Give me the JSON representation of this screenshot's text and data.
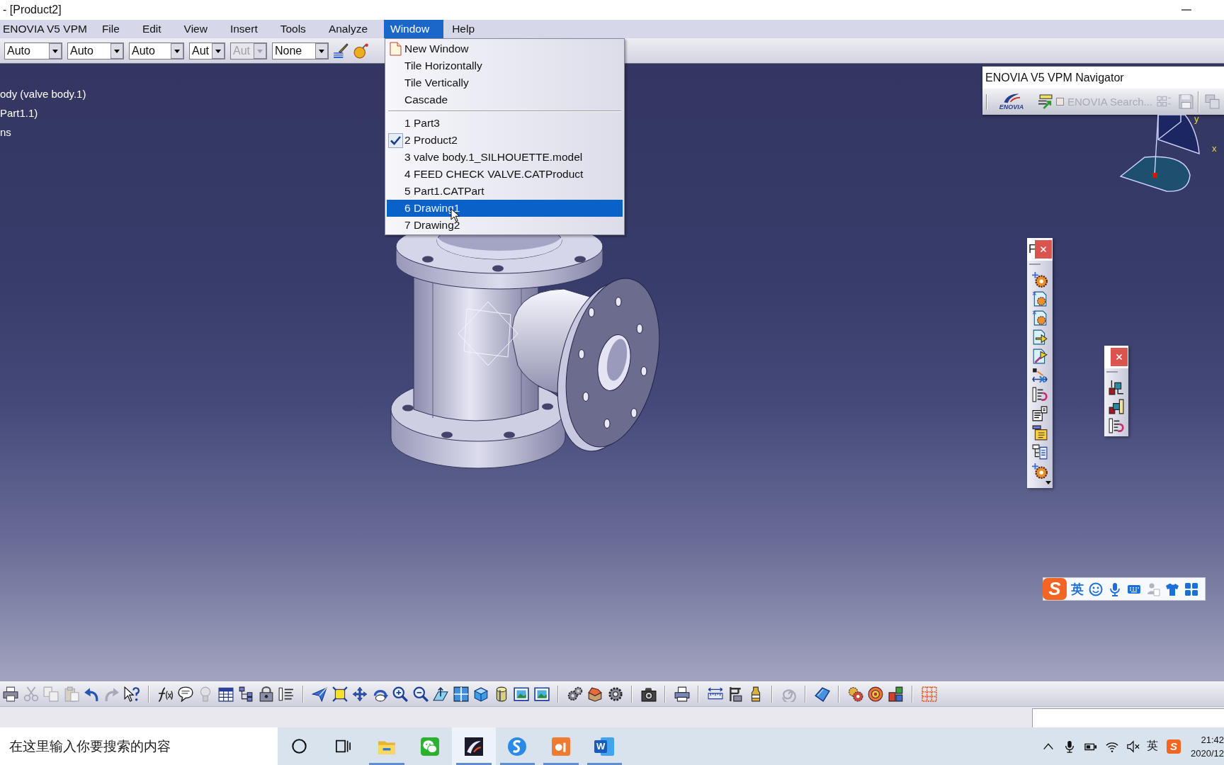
{
  "window": {
    "title": "- [Product2]"
  },
  "menu_bar": [
    {
      "label": "ENOVIA V5 VPM",
      "selected": false
    },
    {
      "label": "File",
      "selected": false
    },
    {
      "label": "Edit",
      "selected": false
    },
    {
      "label": "View",
      "selected": false
    },
    {
      "label": "Insert",
      "selected": false
    },
    {
      "label": "Tools",
      "selected": false
    },
    {
      "label": "Analyze",
      "selected": false
    },
    {
      "label": "Window",
      "selected": true
    },
    {
      "label": "Help",
      "selected": false
    }
  ],
  "graphic_properties": [
    {
      "value": "Auto",
      "disabled": false
    },
    {
      "value": "Auto",
      "disabled": false
    },
    {
      "value": "Auto",
      "disabled": false
    },
    {
      "value": "Aut",
      "disabled": false
    },
    {
      "value": "Aut",
      "disabled": true
    },
    {
      "value": "None",
      "disabled": false
    }
  ],
  "window_menu": [
    {
      "kind": "new",
      "label": "New Window",
      "selected": false
    },
    {
      "kind": "command",
      "label": "Tile Horizontally",
      "selected": false
    },
    {
      "kind": "command",
      "label": "Tile Vertically",
      "selected": false
    },
    {
      "kind": "command",
      "label": "Cascade",
      "selected": false
    },
    {
      "kind": "separator"
    },
    {
      "kind": "window",
      "label": "1 Part3",
      "checked": false,
      "selected": false
    },
    {
      "kind": "window",
      "label": "2 Product2",
      "checked": true,
      "selected": false
    },
    {
      "kind": "window",
      "label": "3 valve body.1_SILHOUETTE.model",
      "checked": false,
      "selected": false
    },
    {
      "kind": "window",
      "label": "4 FEED CHECK VALVE.CATProduct",
      "checked": false,
      "selected": false
    },
    {
      "kind": "window",
      "label": "5 Part1.CATPart",
      "checked": false,
      "selected": false
    },
    {
      "kind": "window",
      "label": "6 Drawing1",
      "checked": false,
      "selected": true
    },
    {
      "kind": "window",
      "label": "7 Drawing2",
      "checked": false,
      "selected": false
    }
  ],
  "specification_tree": [
    "ody (valve body.1)",
    "Part1.1)",
    "ns"
  ],
  "navigator": {
    "title": "ENOVIA V5 VPM Navigator",
    "logo_text": "ENOVIA",
    "search": {
      "label": "ENOVIA Search...",
      "checked": false,
      "disabled": true
    }
  },
  "compass": {
    "axis_labels": [
      "y",
      "x"
    ]
  },
  "floating_toolbar": {
    "title": "F"
  },
  "ime_bar": {
    "logo": "S",
    "mode": "英"
  },
  "taskbar": {
    "search": {
      "placeholder": "在这里输入你要搜索的内容"
    },
    "apps": [
      {
        "kind": "folder",
        "running": true,
        "selected": false
      },
      {
        "kind": "chat",
        "running": false,
        "selected": false
      },
      {
        "kind": "cad",
        "running": true,
        "selected": true
      },
      {
        "kind": "browser",
        "running": true,
        "selected": false
      },
      {
        "kind": "slides",
        "running": true,
        "selected": false
      },
      {
        "kind": "document",
        "label": "W",
        "running": true,
        "selected": false
      }
    ],
    "tray": {
      "ime_mode": "英",
      "ime_logo": "S",
      "time": "21:42",
      "date": "2020/12"
    }
  }
}
